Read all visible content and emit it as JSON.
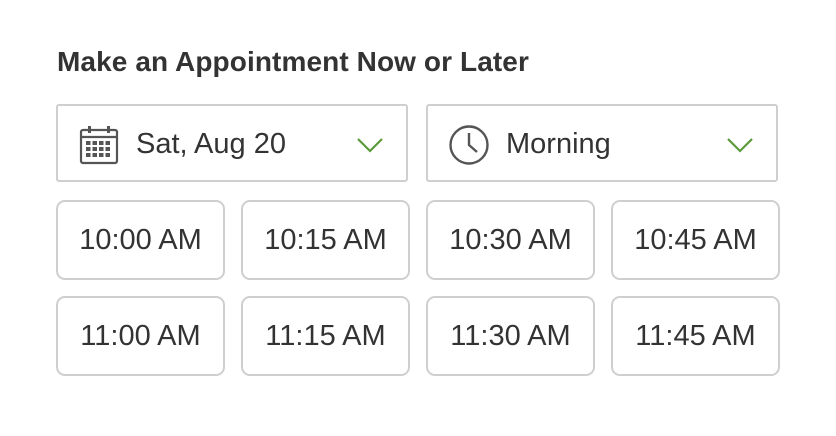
{
  "heading": "Make an Appointment Now or Later",
  "date_select": {
    "value": "Sat, Aug 20",
    "icon": "calendar-icon"
  },
  "period_select": {
    "value": "Morning",
    "icon": "clock-icon"
  },
  "chevron_icon": "chevron-down-icon",
  "colors": {
    "accent": "#5a9a3a",
    "border": "#cfcfcf",
    "text": "#333333",
    "icon": "#555555"
  },
  "time_slots": [
    "10:00 AM",
    "10:15 AM",
    "10:30 AM",
    "10:45 AM",
    "11:00 AM",
    "11:15 AM",
    "11:30 AM",
    "11:45 AM"
  ]
}
